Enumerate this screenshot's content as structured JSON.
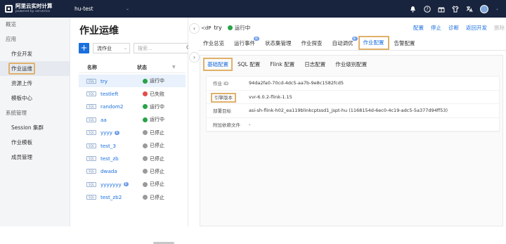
{
  "topbar": {
    "brand_title": "阿里云实时计算",
    "brand_sub": "powered by ververica",
    "workspace": "hu-test",
    "icons": [
      "bell-icon",
      "help-icon",
      "gift-icon",
      "shirt-icon",
      "translate-icon",
      "user-avatar"
    ]
  },
  "sidebar": {
    "overview": "概览",
    "app_group": "应用",
    "dev": "作业开发",
    "ops": "作业运维",
    "upload": "资源上传",
    "template": "模板中心",
    "sys_group": "系统管理",
    "session": "Session 集群",
    "job_template": "作业模板",
    "members": "成员管理"
  },
  "jobs": {
    "title": "作业运维",
    "add_label": "+",
    "flow_select": "流作业",
    "search_placeholder": "搜索...",
    "col_name": "名称",
    "col_status": "状态",
    "sql_tag": "SQL",
    "rows": [
      {
        "name": "try",
        "status": "运行中",
        "state": "run",
        "badge": ""
      },
      {
        "name": "testleft",
        "status": "已失败",
        "state": "fail",
        "badge": ""
      },
      {
        "name": "random2",
        "status": "运行中",
        "state": "run",
        "badge": ""
      },
      {
        "name": "aa",
        "status": "运行中",
        "state": "run",
        "badge": ""
      },
      {
        "name": "yyyy",
        "status": "已停止",
        "state": "stop",
        "badge": "B"
      },
      {
        "name": "test_3",
        "status": "已停止",
        "state": "stop",
        "badge": ""
      },
      {
        "name": "test_zb",
        "status": "已停止",
        "state": "stop",
        "badge": ""
      },
      {
        "name": "dwada",
        "status": "已停止",
        "state": "stop",
        "badge": ""
      },
      {
        "name": "yyyyyyy",
        "status": "已停止",
        "state": "stop",
        "badge": "B"
      },
      {
        "name": "test_zb2",
        "status": "已停止",
        "state": "stop",
        "badge": ""
      }
    ]
  },
  "main": {
    "job_icon": "≺dP",
    "job_name": "try",
    "job_status": "运行中",
    "actions": [
      "配置",
      "停止",
      "诊断",
      "返回开发",
      "删除"
    ],
    "tabs": [
      {
        "label": "作业总览",
        "new": ""
      },
      {
        "label": "运行事件",
        "new": "新"
      },
      {
        "label": "状态集管理",
        "new": ""
      },
      {
        "label": "作业探查",
        "new": ""
      },
      {
        "label": "自动调优",
        "new": "新"
      },
      {
        "label": "作业配置",
        "new": ""
      },
      {
        "label": "告警配置",
        "new": ""
      }
    ],
    "subtabs": [
      "基础配置",
      "SQL 配置",
      "Flink 配置",
      "日志配置",
      "作业级别配置"
    ],
    "info": [
      {
        "label": "作业 ID",
        "value": "94da2fa0-70cd-4dc5-aa7b-9e8c1582fcd5"
      },
      {
        "label": "引擎版本",
        "value": "vvr-6.0.2-flink-1.15"
      },
      {
        "label": "部署目标",
        "value": "asi-sh-flink-h02_ea119blinkcptssd1_jspt-hu (1168154d-6ec0-4c19-adc5-5a377d94ff53)"
      },
      {
        "label": "附加依赖文件",
        "value": "-"
      }
    ]
  }
}
